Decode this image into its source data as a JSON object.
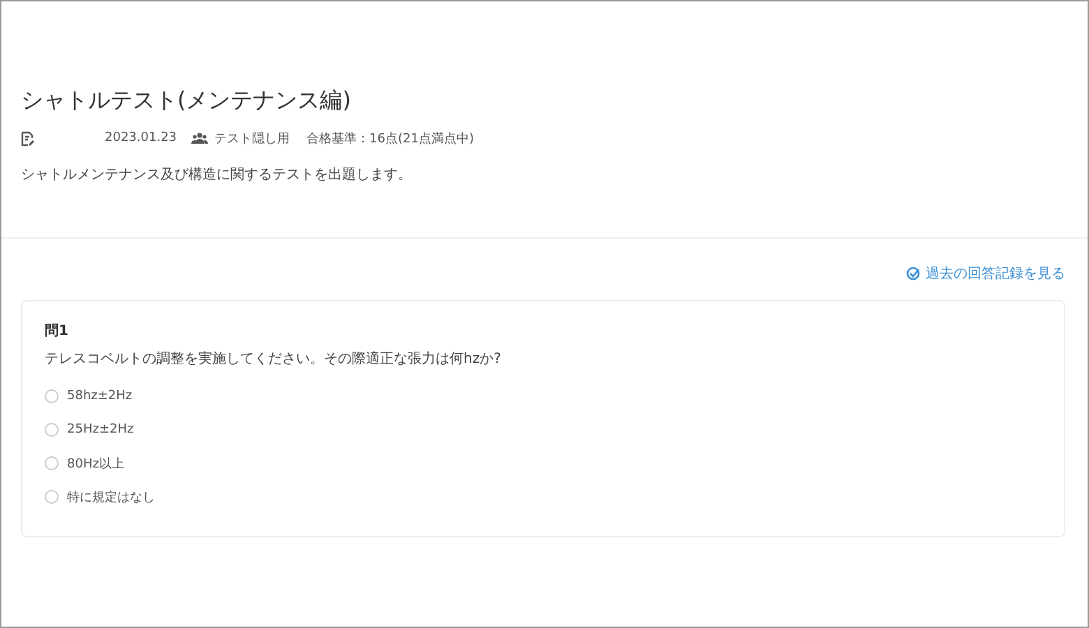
{
  "test": {
    "title": "シャトルテスト(メンテナンス編)",
    "date": "2023.01.23",
    "group": "テスト隠し用",
    "criteria": "合格基準：16点(21点満点中)",
    "description": "シャトルメンテナンス及び構造に関するテストを出題します。"
  },
  "history_link": "過去の回答記録を見る",
  "question": {
    "number": "問1",
    "text": "テレスコベルトの調整を実施してください。その際適正な張力は何hzか?",
    "options": [
      {
        "label": "58hz±2Hz",
        "selected": false
      },
      {
        "label": "25Hz±2Hz",
        "selected": false
      },
      {
        "label": "80Hz以上",
        "selected": false
      },
      {
        "label": "特に規定はなし",
        "selected": false
      }
    ]
  }
}
